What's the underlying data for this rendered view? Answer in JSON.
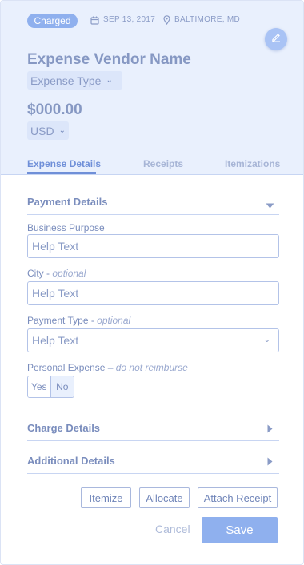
{
  "header": {
    "status_badge": "Charged",
    "date": "SEP 13, 2017",
    "location": "BALTIMORE, MD",
    "vendor_name": "Expense Vendor Name",
    "expense_type": "Expense Type",
    "amount": "$000.00",
    "currency": "USD"
  },
  "tabs": [
    {
      "label": "Expense Details",
      "active": true
    },
    {
      "label": "Receipts",
      "active": false
    },
    {
      "label": "Itemizations",
      "active": false
    }
  ],
  "sections": {
    "payment_details": "Payment Details",
    "charge_details": "Charge Details",
    "additional_details": "Additional Details"
  },
  "fields": {
    "business_purpose": {
      "label": "Business Purpose",
      "value": "Help Text"
    },
    "city": {
      "label": "City - ",
      "optional": "optional",
      "value": "Help Text"
    },
    "payment_type": {
      "label": "Payment Type - ",
      "optional": "optional",
      "value": "Help Text"
    },
    "personal_expense": {
      "label": "Personal Expense – ",
      "note": "do not reimburse",
      "yes": "Yes",
      "no": "No",
      "selected": "No"
    }
  },
  "actions": {
    "itemize": "Itemize",
    "allocate": "Allocate",
    "attach_receipt": "Attach Receipt",
    "cancel": "Cancel",
    "save": "Save"
  },
  "icons": {
    "date": "calendar-icon",
    "location": "map-pin-icon",
    "edit": "pencil-icon",
    "expand": "caret-down-icon",
    "collapse": "caret-right-icon"
  },
  "colors": {
    "accent": "#8fb0ee",
    "header_bg": "#e9f0fd",
    "text": "#6f84b8"
  }
}
